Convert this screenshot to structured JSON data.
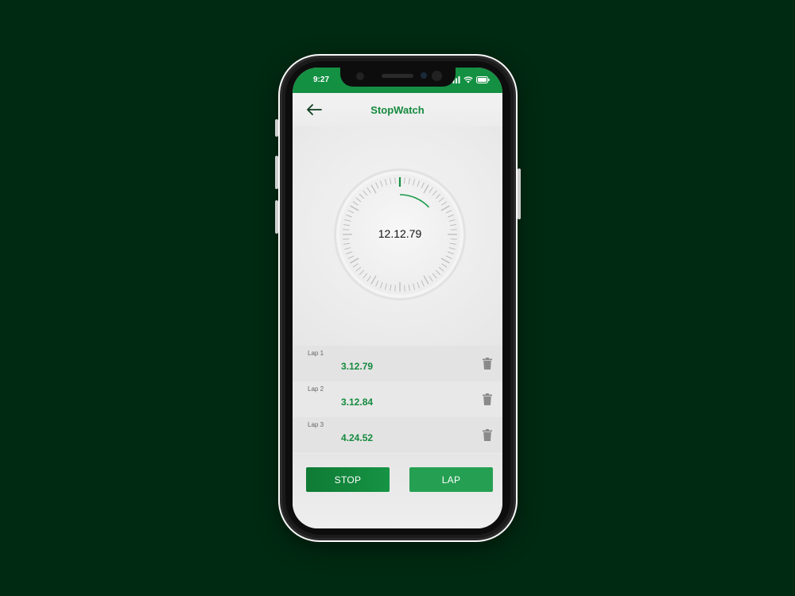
{
  "status": {
    "time": "9:27"
  },
  "header": {
    "title": "StopWatch"
  },
  "stopwatch": {
    "display": "12.12.79",
    "progress": 0.13
  },
  "laps": [
    {
      "label": "Lap 1",
      "time": "3.12.79"
    },
    {
      "label": "Lap 2",
      "time": "3.12.84"
    },
    {
      "label": "Lap 3",
      "time": "4.24.52"
    }
  ],
  "buttons": {
    "stop": "STOP",
    "lap": "LAP"
  },
  "colors": {
    "accent": "#149043",
    "background": "#012a12",
    "text_green": "#148a3e"
  },
  "icons": {
    "back": "arrow-left-icon",
    "delete": "trash-icon",
    "signal": "cellular-signal-icon",
    "wifi": "wifi-icon",
    "battery": "battery-icon"
  }
}
